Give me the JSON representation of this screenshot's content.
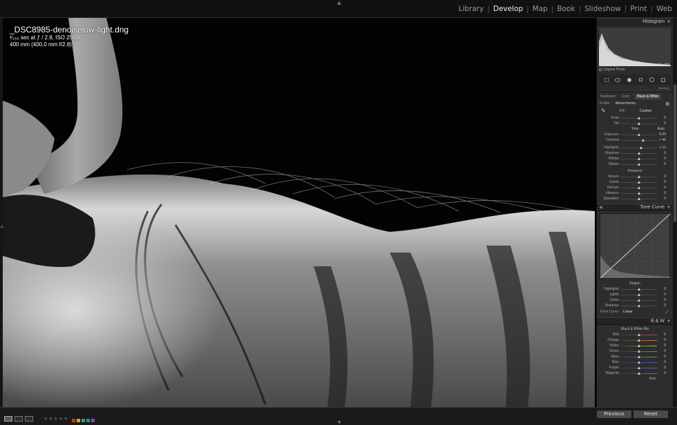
{
  "modules": [
    "Library",
    "Develop",
    "Map",
    "Book",
    "Slideshow",
    "Print",
    "Web"
  ],
  "active_module": "Develop",
  "photo_info": {
    "filename": "_DSC8985-denoiselow-light.dng",
    "exposure": "¹⁄₂₅₀ sec at ƒ / 2.8, ISO 25600",
    "lens": "400 mm (400.0 mm f/2.8)"
  },
  "histogram": {
    "title": "Histogram",
    "iso": "ISO 25600",
    "focal": "400 mm",
    "aperture": "ƒ / 2.8",
    "shutter": "¹⁄₂₅₀ sec",
    "original_photo": "Original Photo"
  },
  "tool_mask_label": "Masking",
  "basic": {
    "treatment_label": "Treatment :",
    "treatment_color": "Color",
    "treatment_bw": "Black & White",
    "profile_label": "Profile :",
    "profile_value": "Monochrome",
    "wb_label": "WB :",
    "wb_value": "Custom",
    "wb_sliders": [
      {
        "label": "Temp",
        "value": "0",
        "pos": 0.5
      },
      {
        "label": "Tint",
        "value": "0",
        "pos": 0.5
      }
    ],
    "tone_title": "Tone",
    "tone_auto": "Auto",
    "tone_sliders": [
      {
        "label": "Exposure",
        "value": "0.00",
        "pos": 0.5
      },
      {
        "label": "Contrast",
        "value": "+ 46",
        "pos": 0.62
      }
    ],
    "tone_sliders2": [
      {
        "label": "Highlights",
        "value": "+ 12",
        "pos": 0.55
      },
      {
        "label": "Shadows",
        "value": "0",
        "pos": 0.5
      },
      {
        "label": "Whites",
        "value": "0",
        "pos": 0.5
      },
      {
        "label": "Blacks",
        "value": "0",
        "pos": 0.5
      }
    ],
    "presence_title": "Presence",
    "presence_sliders": [
      {
        "label": "Texture",
        "value": "0",
        "pos": 0.5
      },
      {
        "label": "Clarity",
        "value": "0",
        "pos": 0.5
      },
      {
        "label": "Dehaze",
        "value": "0",
        "pos": 0.5
      },
      {
        "label": "Vibrance",
        "value": "0",
        "pos": 0.5
      },
      {
        "label": "Saturation",
        "value": "0",
        "pos": 0.5
      }
    ]
  },
  "tone_curve": {
    "title": "Tone Curve",
    "region_title": "Region",
    "region_sliders": [
      {
        "label": "Highlights",
        "value": "0",
        "pos": 0.5
      },
      {
        "label": "Lights",
        "value": "0",
        "pos": 0.5
      },
      {
        "label": "Darks",
        "value": "0",
        "pos": 0.5
      },
      {
        "label": "Shadows",
        "value": "0",
        "pos": 0.5
      }
    ],
    "point_curve_label": "Point Curve :",
    "point_curve_value": "Linear"
  },
  "bw": {
    "title": "B & W",
    "mix_title": "Black & White Mix",
    "sliders": [
      {
        "label": "Red",
        "value": "0",
        "pos": 0.5,
        "color": "#c0504d"
      },
      {
        "label": "Orange",
        "value": "0",
        "pos": 0.5,
        "color": "#d9822b"
      },
      {
        "label": "Yellow",
        "value": "0",
        "pos": 0.5,
        "color": "#c9b53a"
      },
      {
        "label": "Green",
        "value": "0",
        "pos": 0.5,
        "color": "#4ea44e"
      },
      {
        "label": "Aqua",
        "value": "0",
        "pos": 0.5,
        "color": "#3aa8a8"
      },
      {
        "label": "Blue",
        "value": "0",
        "pos": 0.5,
        "color": "#3c6cc8"
      },
      {
        "label": "Purple",
        "value": "0",
        "pos": 0.5,
        "color": "#8a4cc0"
      },
      {
        "label": "Magenta",
        "value": "0",
        "pos": 0.5,
        "color": "#c04ca0"
      }
    ],
    "auto": "Auto"
  },
  "bottom": {
    "previous": "Previous",
    "reset": "Reset",
    "stars": "★★★★★",
    "label_colors": [
      "#c0392b",
      "#d4ac0d",
      "#27ae60",
      "#2e86c1",
      "#8e44ad"
    ]
  }
}
